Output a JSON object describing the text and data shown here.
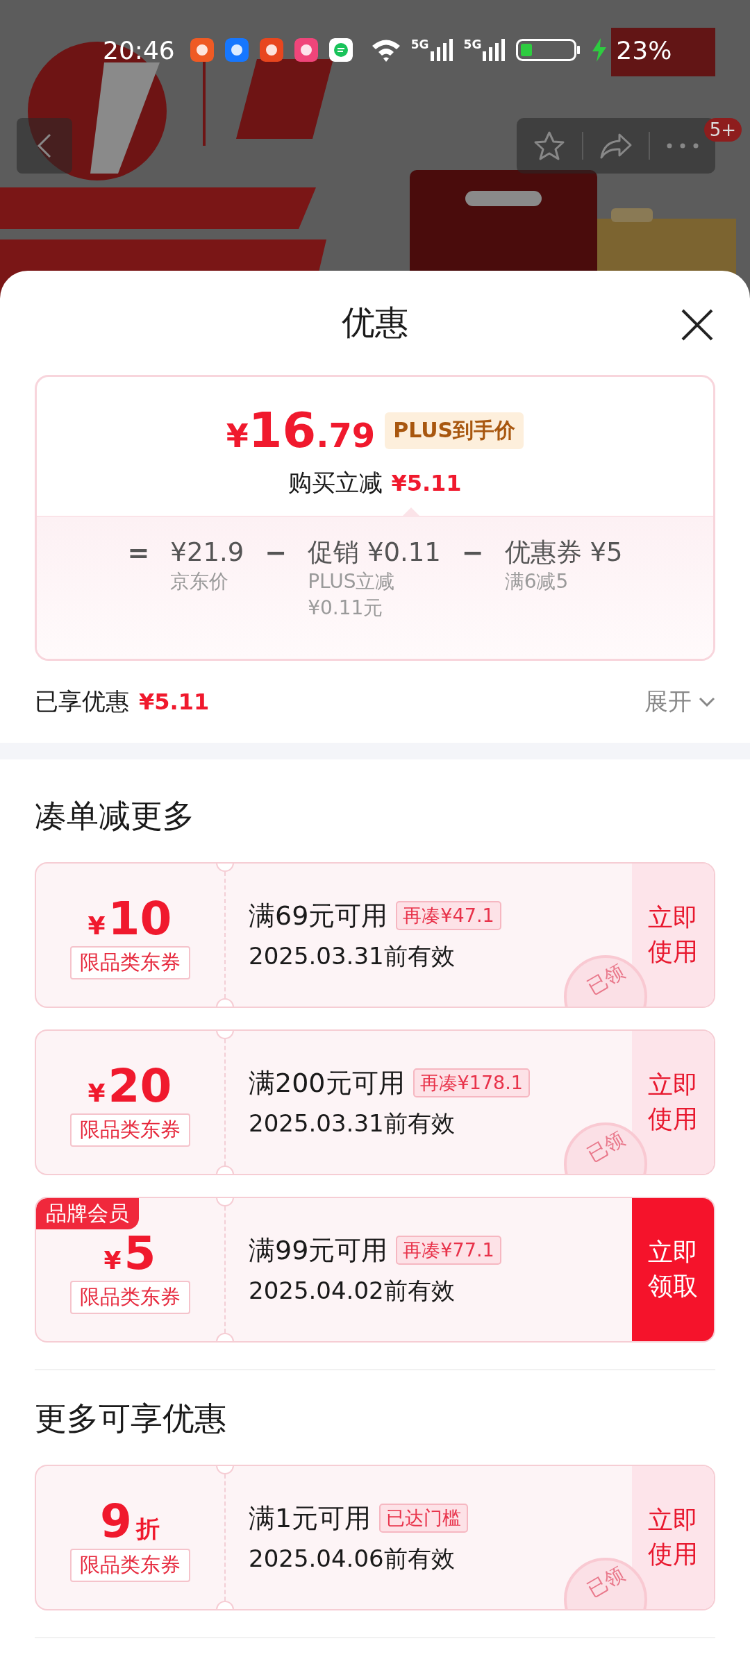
{
  "status_bar": {
    "time": "20:46",
    "network": [
      "5G",
      "5G"
    ],
    "battery": "23%"
  },
  "nav": {
    "badge": "5+"
  },
  "sheet": {
    "title": "优惠",
    "price_card": {
      "price": {
        "currency": "¥",
        "integer": "16",
        "decimal": ".79"
      },
      "price_tag": "PLUS到手价",
      "saving_label": "购买立减",
      "saving_value": "¥5.11",
      "breakdown": [
        {
          "op": "=",
          "value": "¥21.9",
          "notes": [
            "京东价"
          ]
        },
        {
          "op": "−",
          "value": "促销 ¥0.11",
          "notes": [
            "PLUS立减",
            "¥0.11元"
          ]
        },
        {
          "op": "−",
          "value": "优惠券 ¥5",
          "notes": [
            "满6减5"
          ]
        }
      ]
    },
    "enjoyed": {
      "label": "已享优惠",
      "value": "¥5.11",
      "toggle": "展开"
    },
    "sections": [
      {
        "title": "凑单减更多",
        "coupons": [
          {
            "currency": "¥",
            "value": "10",
            "category": "限品类东券",
            "condition": "满69元可用",
            "chip": "再凑¥47.1",
            "validity": "2025.03.31前有效",
            "action": "立即使用",
            "primary": false,
            "stamp": "已领"
          },
          {
            "currency": "¥",
            "value": "20",
            "category": "限品类东券",
            "condition": "满200元可用",
            "chip": "再凑¥178.1",
            "validity": "2025.03.31前有效",
            "action": "立即使用",
            "primary": false,
            "stamp": "已领"
          },
          {
            "tag": "品牌会员",
            "currency": "¥",
            "value": "5",
            "category": "限品类东券",
            "condition": "满99元可用",
            "chip": "再凑¥77.1",
            "validity": "2025.04.02前有效",
            "action": "立即领取",
            "primary": true
          }
        ]
      },
      {
        "title": "更多可享优惠",
        "coupons": [
          {
            "value": "9",
            "unit": "折",
            "category": "限品类东券",
            "condition": "满1元可用",
            "chip": "已达门槛",
            "validity": "2025.04.06前有效",
            "action": "立即使用",
            "primary": false,
            "stamp": "已领"
          }
        ]
      }
    ]
  }
}
